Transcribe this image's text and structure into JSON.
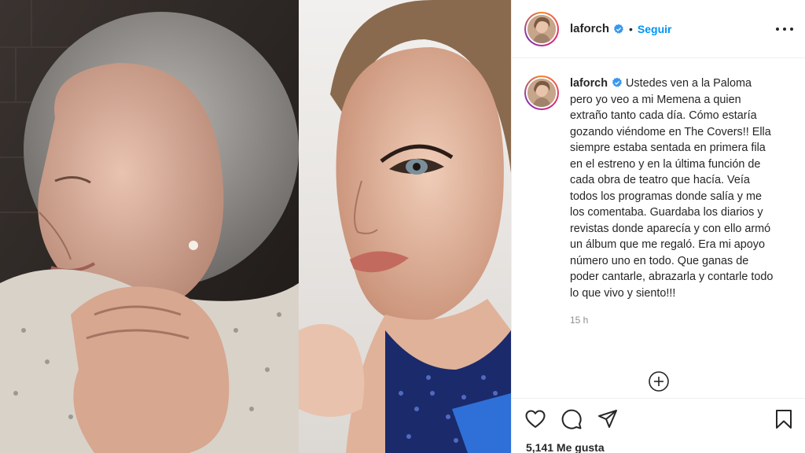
{
  "photos": {
    "left_image": "elderly-woman-portrait",
    "right_image": "woman-stage-makeup-portrait"
  },
  "header": {
    "username": "laforch",
    "separator": "•",
    "follow_label": "Seguir",
    "verified_icon": "verified-badge-icon",
    "more_icon": "more-options-icon"
  },
  "caption": {
    "username": "laforch",
    "text": "Ustedes ven a la Paloma pero yo veo a mi Memena a quien extraño tanto cada día. Cómo estaría gozando viéndome en The Covers!! Ella siempre estaba sentada en primera fila en el estreno y en la última función de cada obra de teatro que hacía. Veía todos los programas donde salía y me los comentaba. Guardaba los diarios y revistas donde aparecía y con ello armó un álbum que me regaló. Era mi apoyo número uno en todo. Que ganas de poder cantarle, abrazarla y contarle todo lo que vivo y siento!!!",
    "time": "15 h"
  },
  "load_more_icon": "plus-circle-icon",
  "actions": {
    "icons": [
      "heart-icon",
      "comment-icon",
      "share-icon",
      "bookmark-icon"
    ],
    "likes": "5,141 Me gusta"
  },
  "colors": {
    "accent": "#0095f6",
    "text": "#262626",
    "muted": "#8e8e8e",
    "border": "#efefef"
  }
}
